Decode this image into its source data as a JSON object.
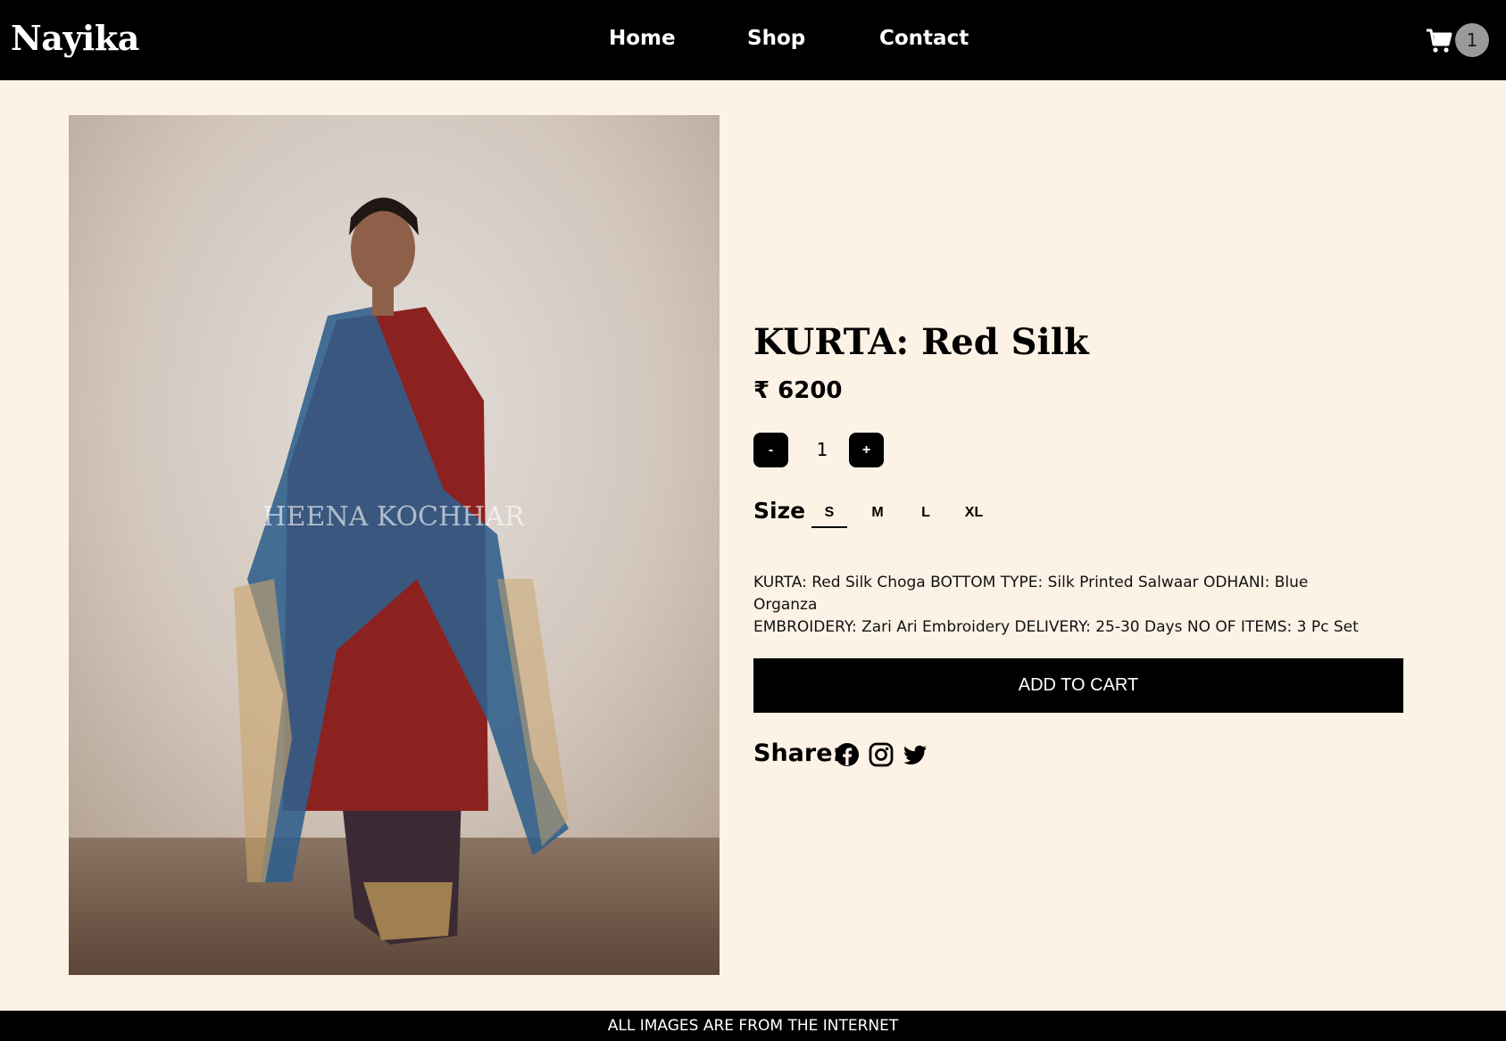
{
  "header": {
    "brand": "Nayika",
    "nav": [
      "Home",
      "Shop",
      "Contact"
    ],
    "cart_count": "1"
  },
  "product": {
    "image_watermark": "HEENA KOCHHAR",
    "title": "KURTA: Red Silk",
    "price": "₹ 6200",
    "quantity": {
      "decrement": "-",
      "value": "1",
      "increment": "+"
    },
    "size_label": "Size",
    "sizes": [
      "S",
      "M",
      "L",
      "XL"
    ],
    "selected_size": "S",
    "description_line1": "KURTA: Red Silk Choga BOTTOM TYPE: Silk Printed Salwaar ODHANI: Blue Organza",
    "description_line2": "EMBROIDERY: Zari Ari Embroidery DELIVERY: 25-30 Days NO OF ITEMS: 3 Pc Set",
    "add_to_cart": "ADD TO CART",
    "share_label": "Share:",
    "share_icons": [
      "facebook-icon",
      "instagram-icon",
      "twitter-icon"
    ]
  },
  "footer": {
    "text": "ALL IMAGES ARE FROM THE INTERNET"
  },
  "colors": {
    "background": "#fdf2e6",
    "header": "#000000",
    "accent": "#000000",
    "cart_badge": "#9a9a9a"
  }
}
